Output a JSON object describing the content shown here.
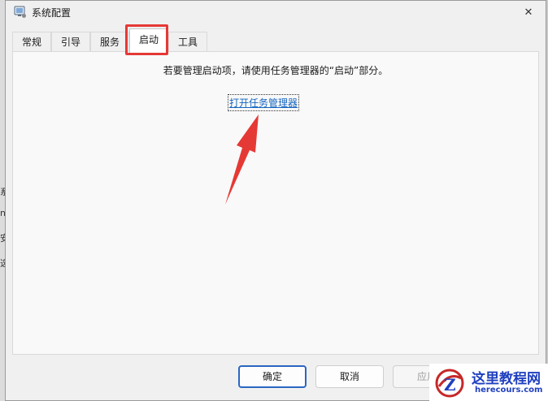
{
  "window": {
    "title": "系统配置",
    "icon": "msconfig-icon",
    "close_symbol": "✕"
  },
  "tabs": [
    "常规",
    "引导",
    "服务",
    "启动",
    "工具"
  ],
  "active_tab": "启动",
  "startup": {
    "message": "若要管理启动项，请使用任务管理器的“启动”部分。",
    "link_label": "打开任务管理器"
  },
  "buttons": {
    "ok": "确定",
    "cancel": "取消",
    "apply": "应用"
  },
  "background_fragments": [
    "系",
    "ni",
    "安",
    "选"
  ],
  "annotation": {
    "color": "#e53935"
  },
  "watermark": {
    "title": "这里教程网",
    "subtitle": "herecours.com"
  }
}
